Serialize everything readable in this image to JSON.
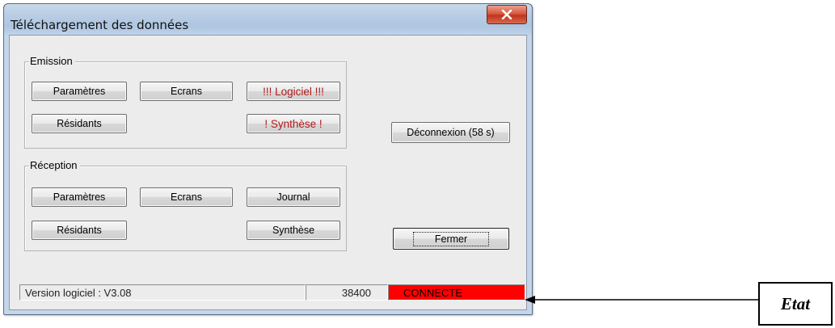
{
  "window": {
    "title": "Téléchargement des données"
  },
  "emission": {
    "legend": "Emission",
    "parametres": "Paramètres",
    "ecrans": "Ecrans",
    "logiciel": "!!! Logiciel !!!",
    "residants": "Résidants",
    "synthese": "! Synthèse !"
  },
  "reception": {
    "legend": "Réception",
    "parametres": "Paramètres",
    "ecrans": "Ecrans",
    "journal": "Journal",
    "residants": "Résidants",
    "synthese": "Synthèse"
  },
  "actions": {
    "deconnexion": "Déconnexion (58 s)",
    "fermer": "Fermer"
  },
  "status": {
    "version": "Version logiciel : V3.08",
    "baud": "38400",
    "state": "CONNECTE",
    "state_color": "#ff0000"
  },
  "annotation": {
    "label": "Etat"
  }
}
